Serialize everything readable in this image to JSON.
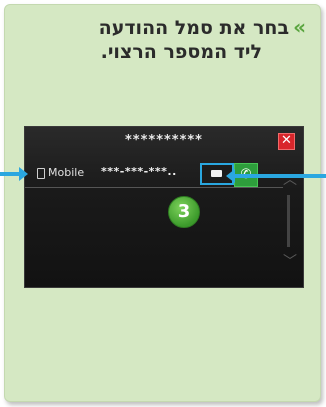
{
  "instruction": {
    "bullet": "»",
    "line1": "בחר את סמל ההודעה",
    "line2": "ליד המספר הרצוי."
  },
  "screen": {
    "title_masked": "**********",
    "close_symbol": "✕",
    "contact": {
      "label": "Mobile",
      "number_masked": "***-***-***.."
    },
    "call_symbol": "✆",
    "scroll_up_symbol": "︿",
    "scroll_down_symbol": "﹀"
  },
  "step_badge": "3",
  "colors": {
    "card_bg": "#d5e8c3",
    "accent_green": "#5aa53f",
    "arrow_blue": "#2aa7e0",
    "close_red": "#d9262b",
    "call_green": "#2e9e3c"
  }
}
